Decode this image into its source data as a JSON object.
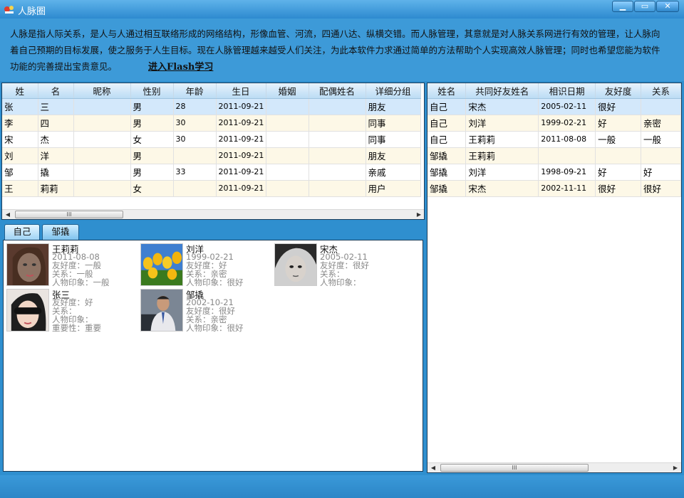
{
  "window": {
    "title": "人脉圈",
    "minimize": "▁",
    "maximize": "▭",
    "close": "✕"
  },
  "banner": {
    "intro": "人脉是指人际关系，是人与人通过相互联络形成的网络结构，形像血管、河流，四通八达、纵横交错。而人脉管理，其意就是对人脉关系网进行有效的管理，让人脉向着自己预期的目标发展，使之服务于人生目标。现在人脉管理越来越受人们关注，为此本软件力求通过简单的方法帮助个人实现高效人脉管理；同时也希望您能为软件功能的完善提出宝贵意见。",
    "flash_link": "进入Flash学习"
  },
  "contacts": {
    "columns": [
      "姓",
      "名",
      "昵称",
      "性别",
      "年龄",
      "生日",
      "婚姻",
      "配偶姓名",
      "详细分组"
    ],
    "rows": [
      [
        "张",
        "三",
        "",
        "男",
        "28",
        "2011-09-21",
        "",
        "",
        "朋友"
      ],
      [
        "李",
        "四",
        "",
        "男",
        "30",
        "2011-09-21",
        "",
        "",
        "同事"
      ],
      [
        "宋",
        "杰",
        "",
        "女",
        "30",
        "2011-09-21",
        "",
        "",
        "同事"
      ],
      [
        "刘",
        "洋",
        "",
        "男",
        "",
        "2011-09-21",
        "",
        "",
        "朋友"
      ],
      [
        "邹",
        "撬",
        "",
        "男",
        "33",
        "2011-09-21",
        "",
        "",
        "亲戚"
      ],
      [
        "王",
        "莉莉",
        "",
        "女",
        "",
        "2011-09-21",
        "",
        "",
        "用户"
      ]
    ]
  },
  "mutual": {
    "columns": [
      "姓名",
      "共同好友姓名",
      "相识日期",
      "友好度",
      "关系"
    ],
    "rows": [
      [
        "自己",
        "宋杰",
        "2005-02-11",
        "很好",
        ""
      ],
      [
        "自己",
        "刘洋",
        "1999-02-21",
        "好",
        "亲密"
      ],
      [
        "自己",
        "王莉莉",
        "2011-08-08",
        "一般",
        "一般"
      ],
      [
        "邹撬",
        "王莉莉",
        "",
        "",
        ""
      ],
      [
        "邹撬",
        "刘洋",
        "1998-09-21",
        "好",
        "好"
      ],
      [
        "邹撬",
        "宋杰",
        "2002-11-11",
        "很好",
        "很好"
      ]
    ]
  },
  "scrollbar": {
    "left": "◀",
    "right": "▶",
    "grip": "III"
  },
  "tabs": [
    "自己",
    "邹撬"
  ],
  "cards": [
    {
      "name": "王莉莉",
      "lines": [
        "2011-08-08",
        "友好度：一般",
        "关系：一般",
        "人物印象：一般"
      ]
    },
    {
      "name": "刘洋",
      "lines": [
        "1999-02-21",
        "友好度：好",
        "关系：亲密",
        "人物印象：很好"
      ]
    },
    {
      "name": "宋杰",
      "lines": [
        "2005-02-11",
        "友好度：很好",
        "关系：",
        "人物印象："
      ]
    },
    {
      "name": "张三",
      "lines": [
        "友好度：好",
        "关系：",
        "人物印象：",
        "重要性：重要"
      ]
    },
    {
      "name": "邹撬",
      "lines": [
        "2002-10-21",
        "友好度：很好",
        "关系：亲密",
        "人物印象：很好"
      ]
    }
  ]
}
